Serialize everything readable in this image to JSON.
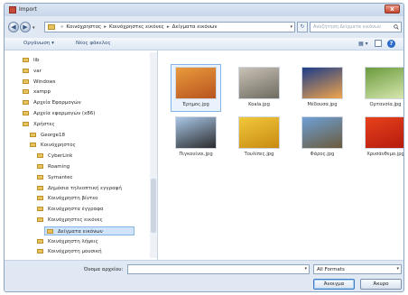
{
  "window": {
    "title": "Import",
    "close_label": "x"
  },
  "nav": {
    "breadcrumbs": [
      "Κοινόχρηστος",
      "Κοινόχρηστες εικόνες",
      "Δείγματα εικόνων"
    ],
    "search_placeholder": "Αναζήτηση Δείγματα εικόνων"
  },
  "toolbar": {
    "organize": "Οργάνωση ▾",
    "new_folder": "Νέος φάκελος"
  },
  "sidebar": {
    "items": [
      {
        "label": "lib",
        "indent": 1
      },
      {
        "label": "var",
        "indent": 1
      },
      {
        "label": "Windows",
        "indent": 1
      },
      {
        "label": "xampp",
        "indent": 1
      },
      {
        "label": "Αρχεία Εφαρμογών",
        "indent": 1
      },
      {
        "label": "Αρχεία εφαρμογών (x86)",
        "indent": 1
      },
      {
        "label": "Χρήστες",
        "indent": 1
      },
      {
        "label": "George18",
        "indent": 2
      },
      {
        "label": "Κοινόχρηστος",
        "indent": 2
      },
      {
        "label": "CyberLink",
        "indent": 3
      },
      {
        "label": "Roaming",
        "indent": 3
      },
      {
        "label": "Symantec",
        "indent": 3
      },
      {
        "label": "Δημόσια τηλεοπτική εγγραφή",
        "indent": 3
      },
      {
        "label": "Κοινόχρηστη βίντεο",
        "indent": 3
      },
      {
        "label": "Κοινόχρηστα έγγραφα",
        "indent": 3
      },
      {
        "label": "Κοινόχρηστες εικόνες",
        "indent": 3
      },
      {
        "label": "Δείγματα εικόνων",
        "indent": 4,
        "selected": true
      },
      {
        "label": "Κοινόχρηστη λήψεις",
        "indent": 3
      },
      {
        "label": "Κοινόχρηστη μουσική",
        "indent": 3
      }
    ]
  },
  "files": [
    {
      "name": "Έρημος.jpg",
      "colors": [
        "#e89a3c",
        "#b8541f"
      ],
      "selected": true
    },
    {
      "name": "Koala.jpg",
      "colors": [
        "#c9c2b6",
        "#6e6a60"
      ]
    },
    {
      "name": "Μέδουσα.jpg",
      "colors": [
        "#1c3c8a",
        "#f1a54a"
      ]
    },
    {
      "name": "Ορτανσία.jpg",
      "colors": [
        "#6a9a3c",
        "#d8e8b0"
      ]
    },
    {
      "name": "Πιγκουίνοι.jpg",
      "colors": [
        "#a9c7e8",
        "#2b2b2b"
      ]
    },
    {
      "name": "Τουλίπες.jpg",
      "colors": [
        "#f1c83a",
        "#c98a12"
      ]
    },
    {
      "name": "Φάρος.jpg",
      "colors": [
        "#6ea0d8",
        "#6a5a3a"
      ]
    },
    {
      "name": "Χρυσάνθεμο.jpg",
      "colors": [
        "#e8421c",
        "#b41a0e"
      ]
    }
  ],
  "footer": {
    "filename_label": "Όνομα αρχείου:",
    "filename_value": "",
    "filetype_value": "All Formats",
    "open_label": "Άνοιγμα",
    "cancel_label": "Άκυρο"
  }
}
